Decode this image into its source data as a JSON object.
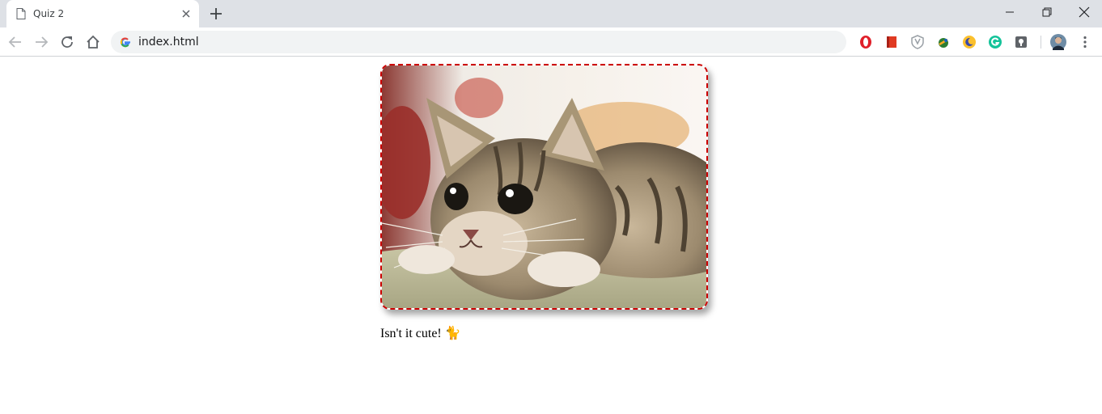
{
  "browser": {
    "tab": {
      "title": "Quiz 2"
    },
    "address_bar": {
      "url": "index.html"
    },
    "extensions": [
      "opera-icon",
      "bookmark-icon",
      "shield-icon",
      "vpn-globe-icon",
      "moon-icon",
      "grammarly-icon",
      "pocket-icon"
    ],
    "colors": {
      "tabstrip": "#dee1e6",
      "omnibox": "#f1f3f4"
    }
  },
  "page": {
    "image": {
      "subject": "kitten",
      "border_color": "#cc0000",
      "border_style": "dashed"
    },
    "caption": "Isn't it cute! 🐈"
  }
}
